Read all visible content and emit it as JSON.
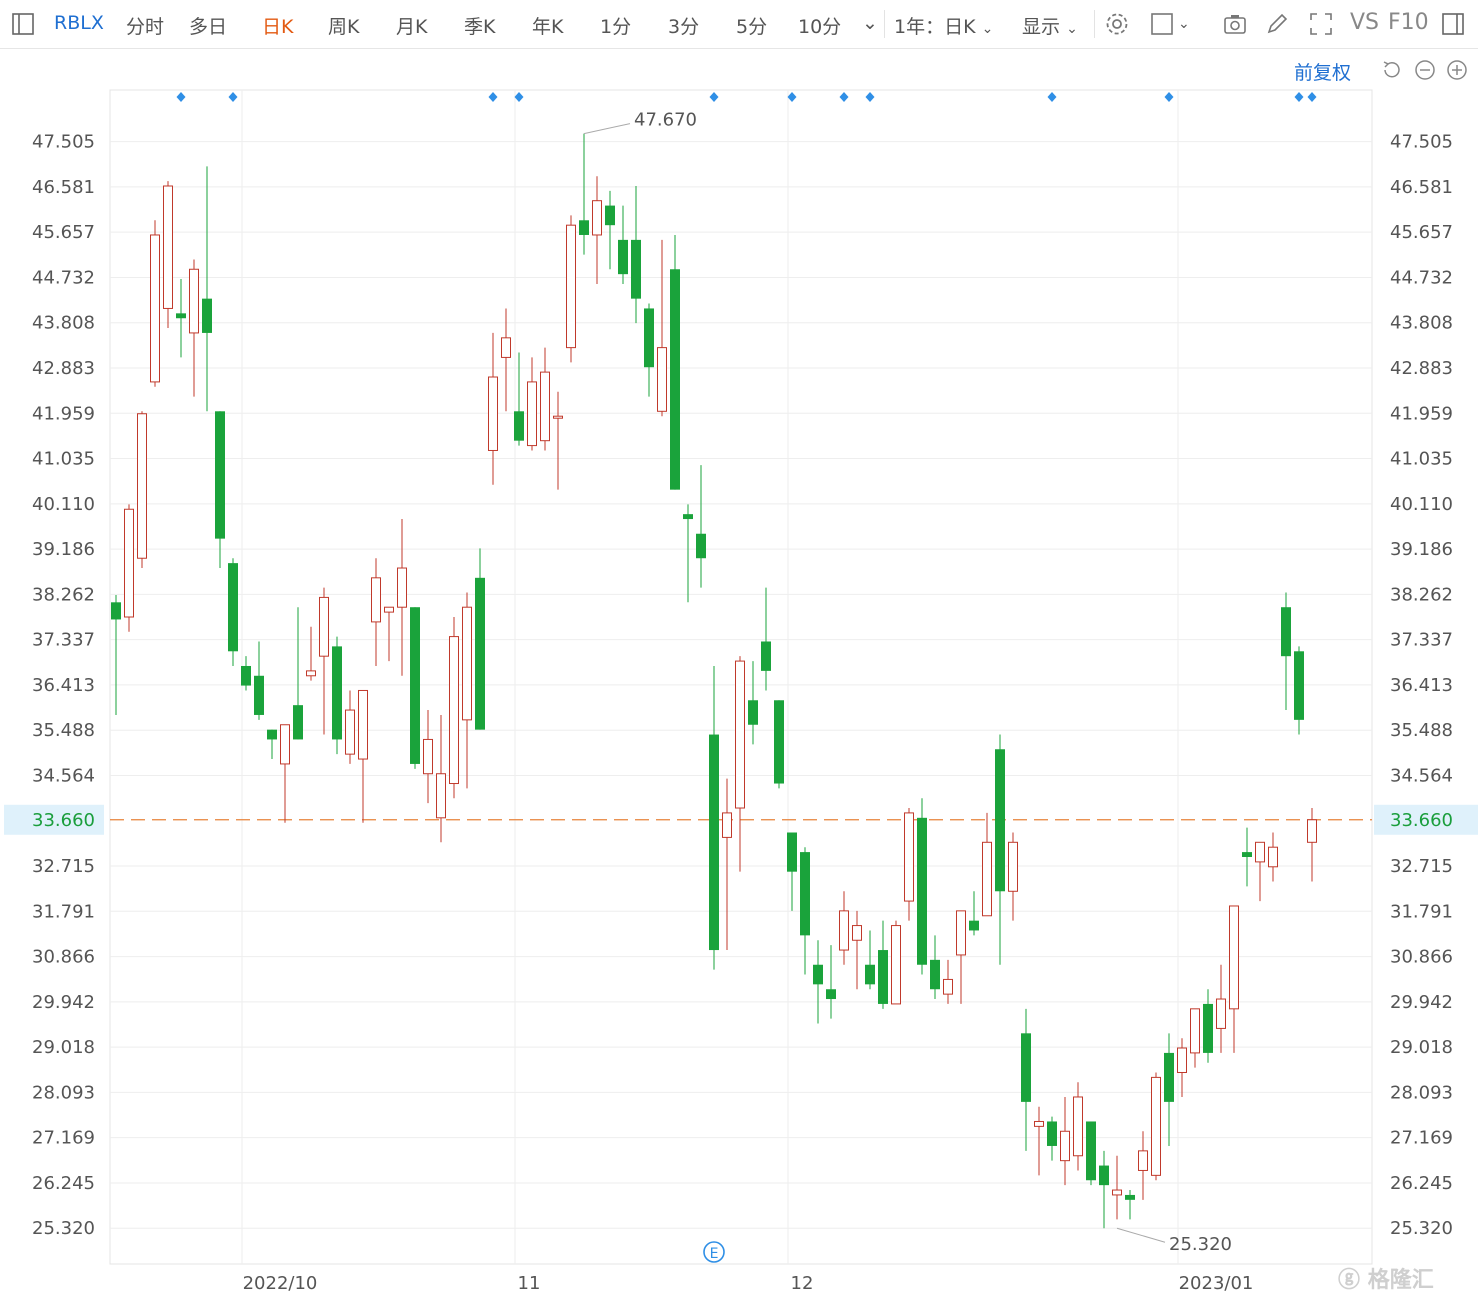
{
  "toolbar": {
    "symbol": "RBLX",
    "tabs": [
      "分时",
      "多日",
      "日K",
      "周K",
      "月K",
      "季K",
      "年K",
      "1分",
      "3分",
      "5分",
      "10分"
    ],
    "active_tab": "日K",
    "range_select": "1年：日K",
    "display_select": "显示",
    "vs_label": "VS",
    "f10_label": "F10"
  },
  "fq_label": "前复权",
  "watermark": "格隆汇",
  "earnings_marker": "E",
  "colors": {
    "up": "#c0392b",
    "down": "#1aa33b",
    "current_line": "#e8823a",
    "marker": "#2f8fe6",
    "current_bg": "#dff1fb"
  },
  "chart_data": {
    "type": "candlestick",
    "y_ticks": [
      "47.505",
      "46.581",
      "45.657",
      "44.732",
      "43.808",
      "42.883",
      "41.959",
      "41.035",
      "40.110",
      "39.186",
      "38.262",
      "37.337",
      "36.413",
      "35.488",
      "34.564",
      "33.660",
      "32.715",
      "31.791",
      "30.866",
      "29.942",
      "29.018",
      "28.093",
      "27.169",
      "26.245",
      "25.320"
    ],
    "ylim": [
      24.59,
      48.56
    ],
    "x_labels": [
      {
        "label": "2022/10",
        "index": 10
      },
      {
        "label": "11",
        "index": 31
      },
      {
        "label": "12",
        "index": 52
      },
      {
        "label": "2023/01",
        "index": 82
      }
    ],
    "current_price": "33.660",
    "high_label": {
      "value": "47.670",
      "index": 36
    },
    "low_label": {
      "value": "25.320",
      "index": 77
    },
    "event_markers": [
      5,
      9,
      29,
      31,
      46,
      52,
      56,
      58,
      72,
      81,
      91,
      92
    ],
    "earnings_index": 46,
    "ohlc": [
      [
        38.1,
        38.25,
        35.8,
        37.75
      ],
      [
        37.8,
        40.1,
        37.5,
        40.0
      ],
      [
        39.0,
        42.0,
        38.8,
        41.95
      ],
      [
        42.6,
        45.9,
        42.5,
        45.6
      ],
      [
        44.1,
        46.7,
        43.7,
        46.6
      ],
      [
        44.0,
        44.7,
        43.1,
        43.9
      ],
      [
        43.6,
        45.1,
        42.3,
        44.9
      ],
      [
        44.3,
        47.0,
        42.0,
        43.6
      ],
      [
        42.0,
        42.0,
        38.8,
        39.4
      ],
      [
        38.9,
        39.0,
        36.8,
        37.1
      ],
      [
        36.8,
        37.0,
        36.3,
        36.4
      ],
      [
        36.6,
        37.3,
        35.7,
        35.8
      ],
      [
        35.5,
        35.5,
        34.9,
        35.3
      ],
      [
        34.8,
        35.6,
        33.6,
        35.6
      ],
      [
        36.0,
        38.0,
        35.3,
        35.3
      ],
      [
        36.6,
        37.6,
        36.5,
        36.7
      ],
      [
        37.0,
        38.4,
        35.4,
        38.2
      ],
      [
        37.2,
        37.4,
        35.0,
        35.3
      ],
      [
        35.0,
        36.3,
        34.8,
        35.9
      ],
      [
        34.9,
        36.3,
        33.6,
        36.3
      ],
      [
        37.7,
        39.0,
        36.8,
        38.6
      ],
      [
        37.9,
        38.0,
        36.9,
        38.0
      ],
      [
        38.0,
        39.8,
        36.6,
        38.8
      ],
      [
        38.0,
        38.0,
        34.7,
        34.8
      ],
      [
        34.6,
        35.9,
        34.0,
        35.3
      ],
      [
        33.7,
        35.8,
        33.2,
        34.6
      ],
      [
        34.4,
        37.8,
        34.1,
        37.4
      ],
      [
        35.7,
        38.3,
        34.3,
        38.0
      ],
      [
        38.6,
        39.2,
        35.5,
        35.5
      ],
      [
        41.2,
        43.6,
        40.5,
        42.7
      ],
      [
        43.1,
        44.1,
        42.0,
        43.5
      ],
      [
        42.0,
        43.2,
        41.3,
        41.4
      ],
      [
        41.3,
        43.1,
        41.2,
        42.6
      ],
      [
        41.4,
        43.3,
        41.2,
        42.8
      ],
      [
        41.9,
        42.4,
        40.4,
        41.9
      ],
      [
        43.3,
        46.0,
        43.0,
        45.8
      ],
      [
        45.9,
        47.67,
        45.2,
        45.6
      ],
      [
        45.6,
        46.8,
        44.6,
        46.3
      ],
      [
        46.2,
        46.5,
        44.9,
        45.8
      ],
      [
        45.5,
        46.2,
        44.6,
        44.8
      ],
      [
        45.5,
        46.6,
        43.8,
        44.3
      ],
      [
        44.1,
        44.2,
        42.3,
        42.9
      ],
      [
        42.0,
        45.5,
        41.9,
        43.3
      ],
      [
        44.9,
        45.6,
        40.4,
        40.4
      ],
      [
        39.9,
        40.1,
        38.1,
        39.8
      ],
      [
        39.5,
        40.9,
        38.4,
        39.0
      ],
      [
        35.4,
        36.8,
        30.6,
        31.0
      ],
      [
        33.3,
        34.5,
        31.0,
        33.8
      ],
      [
        33.9,
        37.0,
        32.6,
        36.9
      ],
      [
        36.1,
        36.9,
        35.2,
        35.6
      ],
      [
        37.3,
        38.4,
        36.3,
        36.7
      ],
      [
        36.1,
        36.1,
        34.3,
        34.4
      ],
      [
        33.4,
        33.4,
        31.8,
        32.6
      ],
      [
        33.0,
        33.1,
        30.5,
        31.3
      ],
      [
        30.7,
        31.2,
        29.5,
        30.3
      ],
      [
        30.2,
        31.1,
        29.6,
        30.0
      ],
      [
        31.0,
        32.2,
        30.7,
        31.8
      ],
      [
        31.2,
        31.8,
        30.2,
        31.5
      ],
      [
        30.7,
        31.4,
        30.2,
        30.3
      ],
      [
        31.0,
        31.6,
        29.8,
        29.9
      ],
      [
        29.9,
        31.6,
        29.9,
        31.5
      ],
      [
        32.0,
        33.9,
        31.6,
        33.8
      ],
      [
        33.7,
        34.1,
        30.5,
        30.7
      ],
      [
        30.8,
        31.3,
        30.0,
        30.2
      ],
      [
        30.1,
        30.8,
        29.9,
        30.4
      ],
      [
        30.9,
        31.5,
        29.9,
        31.8
      ],
      [
        31.6,
        32.2,
        31.3,
        31.4
      ],
      [
        31.7,
        33.8,
        31.7,
        33.2
      ],
      [
        35.1,
        35.4,
        30.7,
        32.2
      ],
      [
        32.2,
        33.4,
        31.6,
        33.2
      ],
      [
        29.3,
        29.8,
        26.9,
        27.9
      ],
      [
        27.4,
        27.8,
        26.4,
        27.5
      ],
      [
        27.5,
        27.6,
        26.7,
        27.0
      ],
      [
        26.7,
        28.0,
        26.2,
        27.3
      ],
      [
        26.8,
        28.3,
        26.5,
        28.0
      ],
      [
        27.5,
        27.5,
        26.2,
        26.3
      ],
      [
        26.6,
        26.9,
        25.32,
        26.2
      ],
      [
        26.0,
        26.8,
        25.5,
        26.1
      ],
      [
        26.0,
        26.1,
        25.5,
        25.9
      ],
      [
        26.5,
        27.3,
        25.9,
        26.9
      ],
      [
        26.4,
        28.5,
        26.3,
        28.4
      ],
      [
        28.9,
        29.3,
        27.0,
        27.9
      ],
      [
        28.5,
        29.2,
        28.0,
        29.0
      ],
      [
        28.9,
        29.6,
        28.6,
        29.8
      ],
      [
        29.9,
        30.2,
        28.7,
        28.9
      ],
      [
        29.4,
        30.7,
        28.9,
        30.0
      ],
      [
        29.8,
        30.8,
        28.9,
        31.9
      ],
      [
        33.0,
        33.5,
        32.3,
        32.9
      ],
      [
        32.8,
        33.2,
        32.0,
        33.2
      ],
      [
        32.7,
        33.4,
        32.4,
        33.1
      ],
      [
        38.0,
        38.3,
        35.9,
        37.0
      ],
      [
        37.1,
        37.2,
        35.4,
        35.7
      ],
      [
        33.2,
        33.9,
        32.4,
        33.66
      ]
    ]
  }
}
